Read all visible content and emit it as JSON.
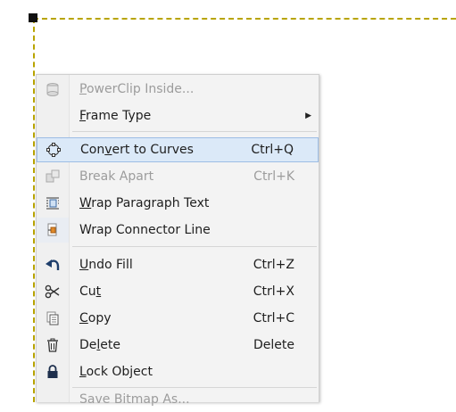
{
  "menu": {
    "items": [
      {
        "label": "PowerClip Inside...",
        "shortcut": "",
        "enabled": false,
        "icon": "powerclip-icon"
      },
      {
        "label": "Frame Type",
        "shortcut": "",
        "enabled": true,
        "submenu": true,
        "icon": ""
      },
      {
        "label": "Convert to Curves",
        "shortcut": "Ctrl+Q",
        "enabled": true,
        "highlighted": true,
        "icon": "convert-curves-icon"
      },
      {
        "label": "Break Apart",
        "shortcut": "Ctrl+K",
        "enabled": false,
        "icon": "break-apart-icon"
      },
      {
        "label": "Wrap Paragraph Text",
        "shortcut": "",
        "enabled": true,
        "icon": "wrap-text-icon"
      },
      {
        "label": "Wrap Connector Line",
        "shortcut": "",
        "enabled": true,
        "icon": "wrap-connector-icon"
      },
      {
        "label": "Undo Fill",
        "shortcut": "Ctrl+Z",
        "enabled": true,
        "icon": "undo-icon"
      },
      {
        "label": "Cut",
        "shortcut": "Ctrl+X",
        "enabled": true,
        "icon": "scissors-icon"
      },
      {
        "label": "Copy",
        "shortcut": "Ctrl+C",
        "enabled": true,
        "icon": "copy-icon"
      },
      {
        "label": "Delete",
        "shortcut": "Delete",
        "enabled": true,
        "icon": "trash-icon"
      },
      {
        "label": "Lock Object",
        "shortcut": "",
        "enabled": true,
        "icon": "lock-icon"
      },
      {
        "label": "Save Bitmap As...",
        "shortcut": "",
        "enabled": false,
        "icon": ""
      }
    ]
  },
  "colors": {
    "highlight": "#dbe9f8",
    "highlight_border": "#9dbde4",
    "frame_dash": "#b8a400"
  }
}
